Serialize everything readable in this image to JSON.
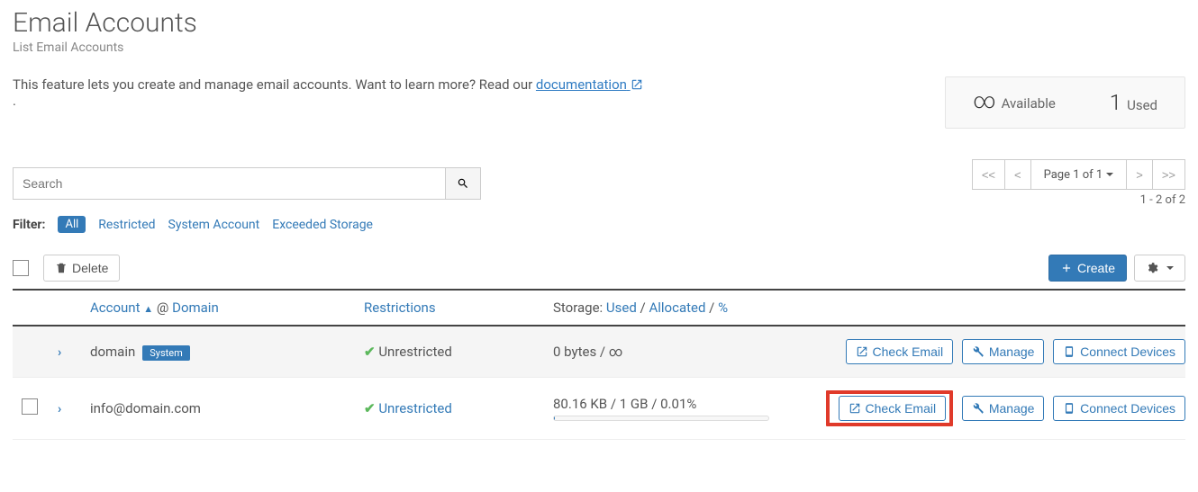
{
  "header": {
    "title": "Email Accounts",
    "subtitle": "List Email Accounts",
    "intro_prefix": "This feature lets you create and manage email accounts. Want to learn more? Read our ",
    "intro_link": "documentation",
    "intro_suffix": " ."
  },
  "stats": {
    "available_value": "∞",
    "available_label": "Available",
    "used_value": "1",
    "used_label": "Used"
  },
  "search": {
    "placeholder": "Search"
  },
  "pager": {
    "first": "<<",
    "prev": "<",
    "info": "Page 1 of 1",
    "next": ">",
    "last": ">>",
    "range": "1 - 2 of 2"
  },
  "filter": {
    "label": "Filter:",
    "all": "All",
    "restricted": "Restricted",
    "system": "System Account",
    "exceeded": "Exceeded Storage"
  },
  "actions": {
    "delete": "Delete",
    "create": "Create"
  },
  "columns": {
    "account": "Account",
    "at": "@",
    "domain": "Domain",
    "restrictions": "Restrictions",
    "storage_prefix": "Storage:",
    "used": "Used",
    "allocated": "Allocated",
    "percent": "%"
  },
  "rows": [
    {
      "account": "domain",
      "system_badge": "System",
      "restriction": "Unrestricted",
      "restriction_link": false,
      "storage_text": "0 bytes / ∞",
      "show_bar": false,
      "check_email": "Check Email",
      "manage": "Manage",
      "connect": "Connect Devices",
      "highlight": false,
      "show_checkbox": false
    },
    {
      "account": "info@domain.com",
      "system_badge": "",
      "restriction": "Unrestricted",
      "restriction_link": true,
      "storage_text": "80.16 KB / 1 GB / 0.01%",
      "show_bar": true,
      "check_email": "Check Email",
      "manage": "Manage",
      "connect": "Connect Devices",
      "highlight": true,
      "show_checkbox": true
    }
  ]
}
